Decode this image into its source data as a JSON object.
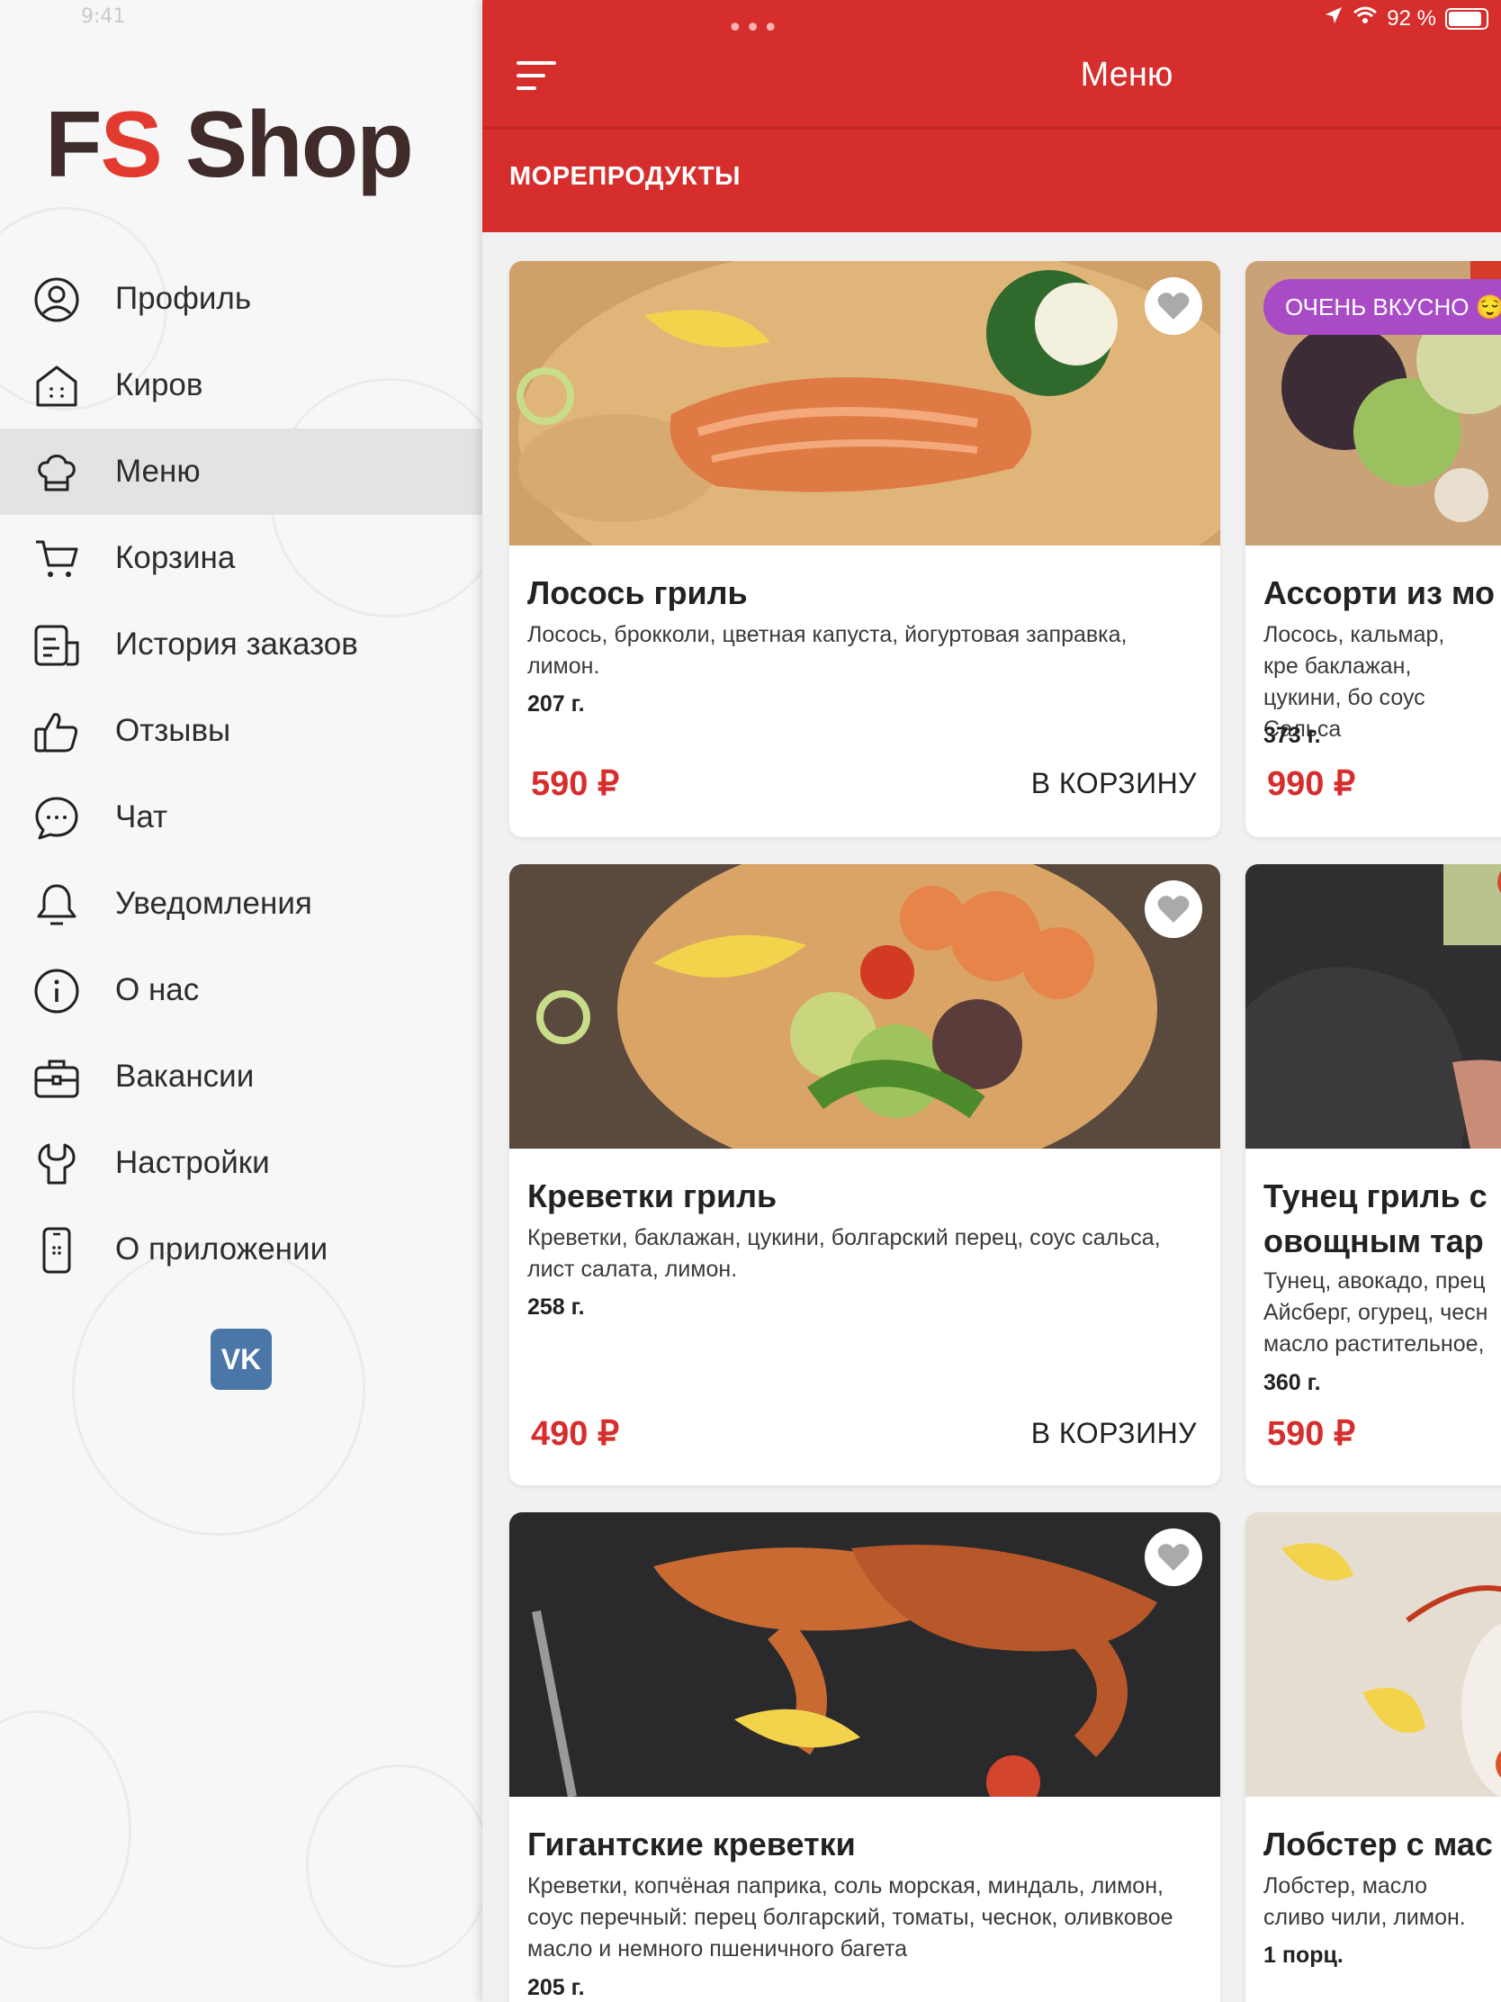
{
  "status_bar": {
    "left_text": "9:41",
    "battery": "92 %"
  },
  "app": {
    "logo_part1": "FS",
    "logo_part2": "Shop"
  },
  "sidebar": {
    "items": [
      {
        "label": "Профиль",
        "icon": "user-icon"
      },
      {
        "label": "Киров",
        "icon": "store-icon"
      },
      {
        "label": "Меню",
        "icon": "chef-hat-icon",
        "active": true
      },
      {
        "label": "Корзина",
        "icon": "cart-icon"
      },
      {
        "label": "История заказов",
        "icon": "order-history-icon"
      },
      {
        "label": "Отзывы",
        "icon": "thumbs-up-icon"
      },
      {
        "label": "Чат",
        "icon": "chat-icon"
      },
      {
        "label": "Уведомления",
        "icon": "bell-icon"
      },
      {
        "label": "О нас",
        "icon": "info-icon"
      },
      {
        "label": "Вакансии",
        "icon": "briefcase-icon"
      },
      {
        "label": "Настройки",
        "icon": "wrench-icon"
      },
      {
        "label": "О приложении",
        "icon": "phone-icon"
      }
    ],
    "vk_label": "VK"
  },
  "header": {
    "title": "Меню",
    "category": "МОРЕПРОДУКТЫ"
  },
  "colors": {
    "accent": "#d62d2d",
    "badge": "#a94bc7",
    "vk": "#4a76a8"
  },
  "products": [
    {
      "name": "Лосось гриль",
      "desc": "Лосось, брокколи, цветная капуста, йогуртовая заправка, лимон.",
      "weight": "207 г.",
      "price": "590 ₽",
      "action": "В КОРЗИНУ"
    },
    {
      "name": "Ассорти из мо",
      "badge": "ОЧЕНЬ ВКУСНО 😌",
      "desc": "Лосось, кальмар, кре баклажан, цукини, бо соус Сальса",
      "weight": "373 г.",
      "price": "990 ₽"
    },
    {
      "name": "Креветки гриль",
      "desc": "Креветки, баклажан, цукини, болгарский перец, соус сальса, лист салата, лимон.",
      "weight": "258 г.",
      "price": "490 ₽",
      "action": "В КОРЗИНУ"
    },
    {
      "name_line1": "Тунец гриль с",
      "name_line2": "овощным тар",
      "desc": "Тунец, авокадо, прец Айсберг, огурец, чесн масло растительное,",
      "weight": "360 г.",
      "price": "590 ₽"
    },
    {
      "name": "Гигантские креветки",
      "desc": "Креветки, копчёная паприка, соль морская, миндаль, лимон, соус перечный: перец болгарский, томаты, чеснок, оливковое масло и немного пшеничного багета",
      "weight": "205 г."
    },
    {
      "name": "Лобстер с мас",
      "desc": "Лобстер, масло сливо чили, лимон.",
      "weight": "1 порц."
    }
  ]
}
